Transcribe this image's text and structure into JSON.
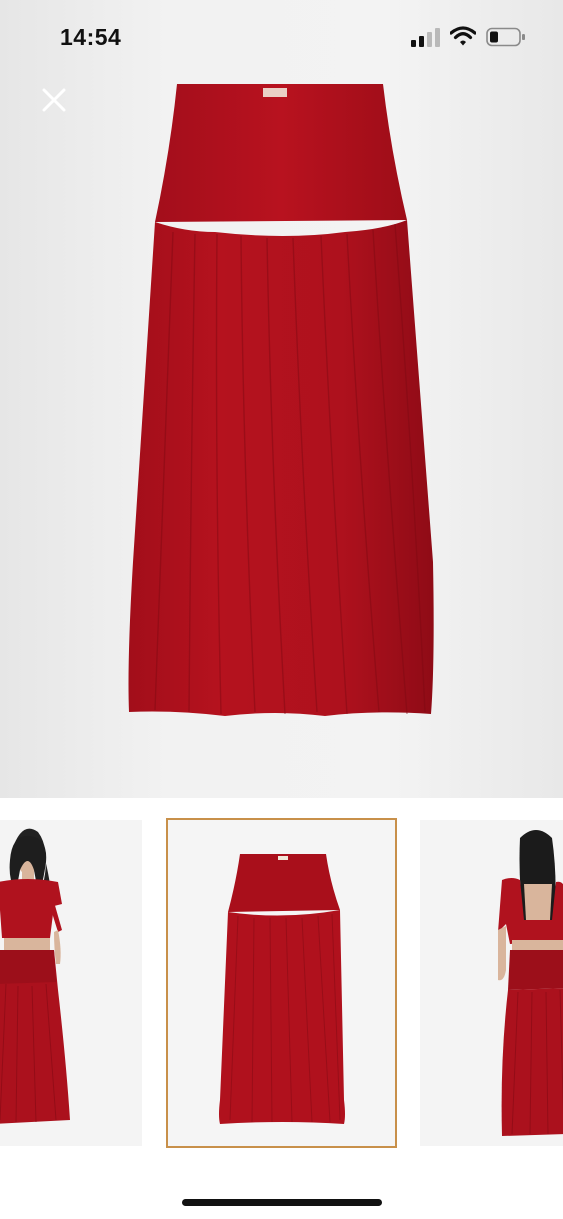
{
  "status_bar": {
    "time": "14:54"
  },
  "gallery": {
    "selected_index": 1,
    "thumbnail_count": 3,
    "thumbnails": [
      {
        "label": "model-front-view"
      },
      {
        "label": "product-flat-view"
      },
      {
        "label": "model-back-view"
      }
    ]
  },
  "colors": {
    "skirt": "#b1101c",
    "skirt_dark": "#8d0a14",
    "selected_border": "#c8904a"
  }
}
